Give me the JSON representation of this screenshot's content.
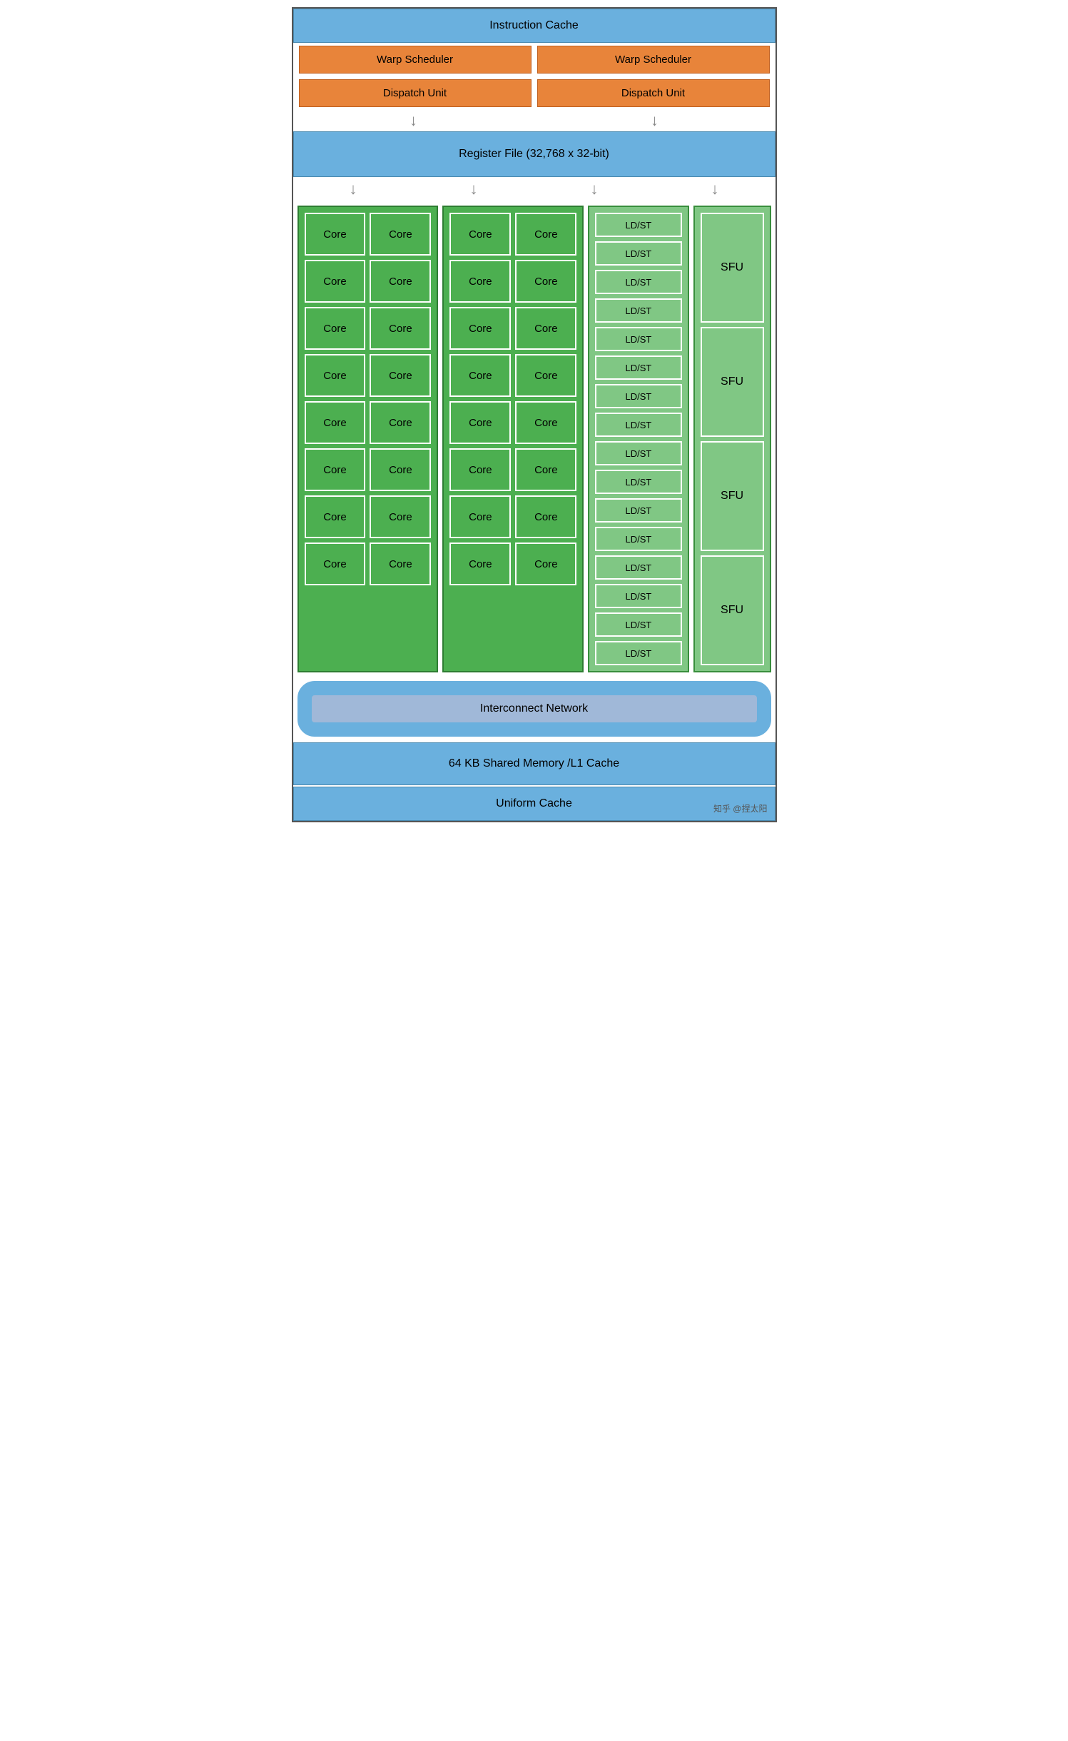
{
  "header": {
    "instruction_cache": "Instruction Cache"
  },
  "warp_schedulers": [
    "Warp Scheduler",
    "Warp Scheduler"
  ],
  "dispatch_units": [
    "Dispatch Unit",
    "Dispatch Unit"
  ],
  "register_file": "Register File (32,768 x 32-bit)",
  "core_group_1": {
    "rows": [
      [
        "Core",
        "Core"
      ],
      [
        "Core",
        "Core"
      ],
      [
        "Core",
        "Core"
      ],
      [
        "Core",
        "Core"
      ],
      [
        "Core",
        "Core"
      ],
      [
        "Core",
        "Core"
      ],
      [
        "Core",
        "Core"
      ],
      [
        "Core",
        "Core"
      ]
    ]
  },
  "core_group_2": {
    "rows": [
      [
        "Core",
        "Core"
      ],
      [
        "Core",
        "Core"
      ],
      [
        "Core",
        "Core"
      ],
      [
        "Core",
        "Core"
      ],
      [
        "Core",
        "Core"
      ],
      [
        "Core",
        "Core"
      ],
      [
        "Core",
        "Core"
      ],
      [
        "Core",
        "Core"
      ]
    ]
  },
  "ldst_units": [
    "LD/ST",
    "LD/ST",
    "LD/ST",
    "LD/ST",
    "LD/ST",
    "LD/ST",
    "LD/ST",
    "LD/ST",
    "LD/ST",
    "LD/ST",
    "LD/ST",
    "LD/ST",
    "LD/ST",
    "LD/ST",
    "LD/ST",
    "LD/ST"
  ],
  "sfu_units": [
    "SFU",
    "SFU",
    "SFU",
    "SFU"
  ],
  "interconnect": "Interconnect Network",
  "shared_memory": "64 KB Shared Memory /L1 Cache",
  "uniform_cache": "Uniform Cache",
  "watermark": "知乎 @捏太阳",
  "arrows": [
    "↓",
    "↓",
    "↓",
    "↓"
  ]
}
